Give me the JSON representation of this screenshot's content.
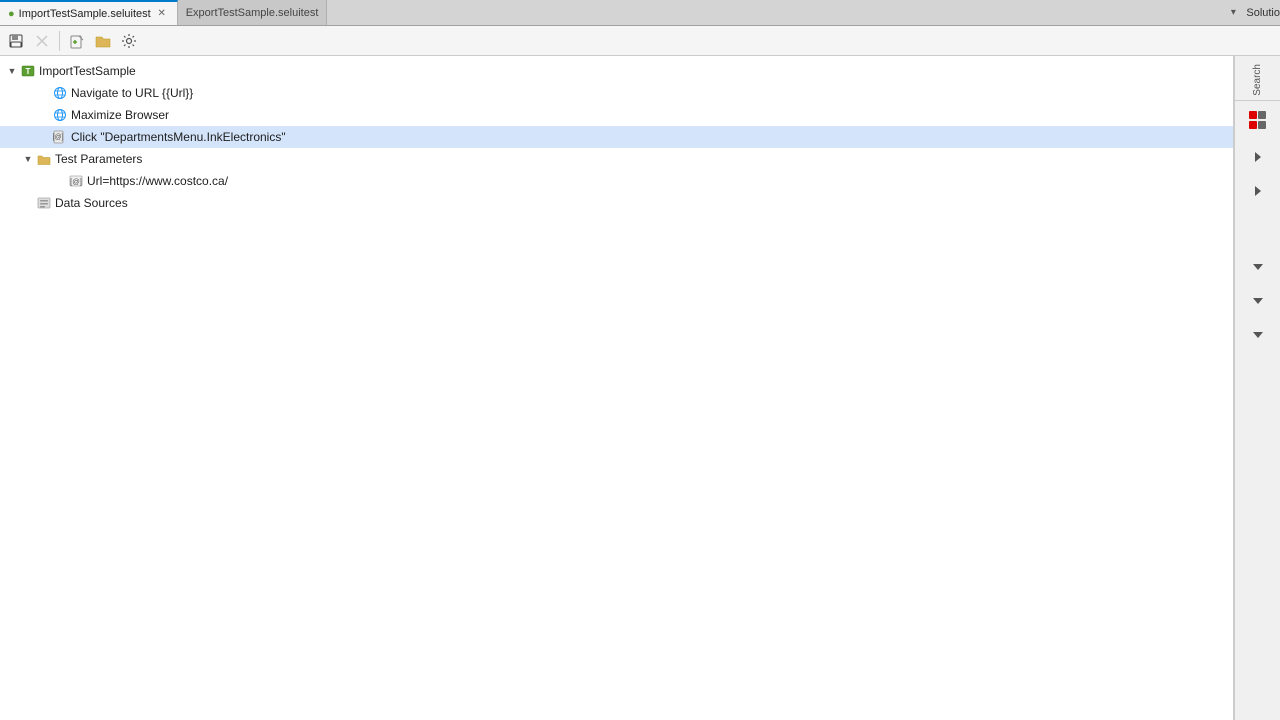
{
  "tabs": [
    {
      "id": "import-tab",
      "label": "ImportTestSample.seluitest",
      "active": true,
      "closable": true
    },
    {
      "id": "export-tab",
      "label": "ExportTestSample.seluitest",
      "active": false,
      "closable": false
    }
  ],
  "tab_overflow_icon": "▾",
  "solution_label": "Solutio",
  "toolbar": {
    "buttons": [
      {
        "id": "save-btn",
        "icon": "💾",
        "label": "Save",
        "disabled": false
      },
      {
        "id": "close-btn",
        "icon": "✕",
        "label": "Close",
        "disabled": false
      },
      {
        "id": "add-btn",
        "icon": "📄+",
        "label": "Add",
        "disabled": false
      },
      {
        "id": "folder-btn",
        "icon": "📁",
        "label": "Folder",
        "disabled": false
      },
      {
        "id": "settings-btn",
        "icon": "⚙",
        "label": "Settings",
        "disabled": false
      }
    ]
  },
  "tree": {
    "root": {
      "id": "import-test-sample",
      "label": "ImportTestSample",
      "expanded": true,
      "icon": "test",
      "children": [
        {
          "id": "navigate-url",
          "label": "Navigate to URL {{Url}}",
          "icon": "globe",
          "indent": 1
        },
        {
          "id": "maximize-browser",
          "label": "Maximize Browser",
          "icon": "globe",
          "indent": 1
        },
        {
          "id": "click-departments",
          "label": "Click \"DepartmentsMenu.InkElectronics\"",
          "icon": "click",
          "indent": 1,
          "selected": false
        },
        {
          "id": "test-parameters",
          "label": "Test Parameters",
          "icon": "folder",
          "indent": 1,
          "expanded": true,
          "children": [
            {
              "id": "url-param",
              "label": "Url=https://www.costco.ca/",
              "icon": "param",
              "indent": 2
            }
          ]
        },
        {
          "id": "data-sources",
          "label": "Data Sources",
          "icon": "datasource",
          "indent": 1
        }
      ]
    }
  },
  "right_sidebar": {
    "search_label": "Search",
    "buttons": [
      {
        "id": "arrow-right-1",
        "icon": "▶"
      },
      {
        "id": "arrow-right-2",
        "icon": "▶"
      },
      {
        "id": "arrow-down-1",
        "icon": "▼"
      },
      {
        "id": "arrow-down-2",
        "icon": "▼"
      },
      {
        "id": "arrow-down-3",
        "icon": "▼"
      }
    ]
  },
  "colors": {
    "active_tab_bg": "#f5f5f5",
    "inactive_tab_bg": "#c8c8c8",
    "tree_bg": "#ffffff",
    "sidebar_bg": "#f0f0f0",
    "accent": "#007acc"
  }
}
